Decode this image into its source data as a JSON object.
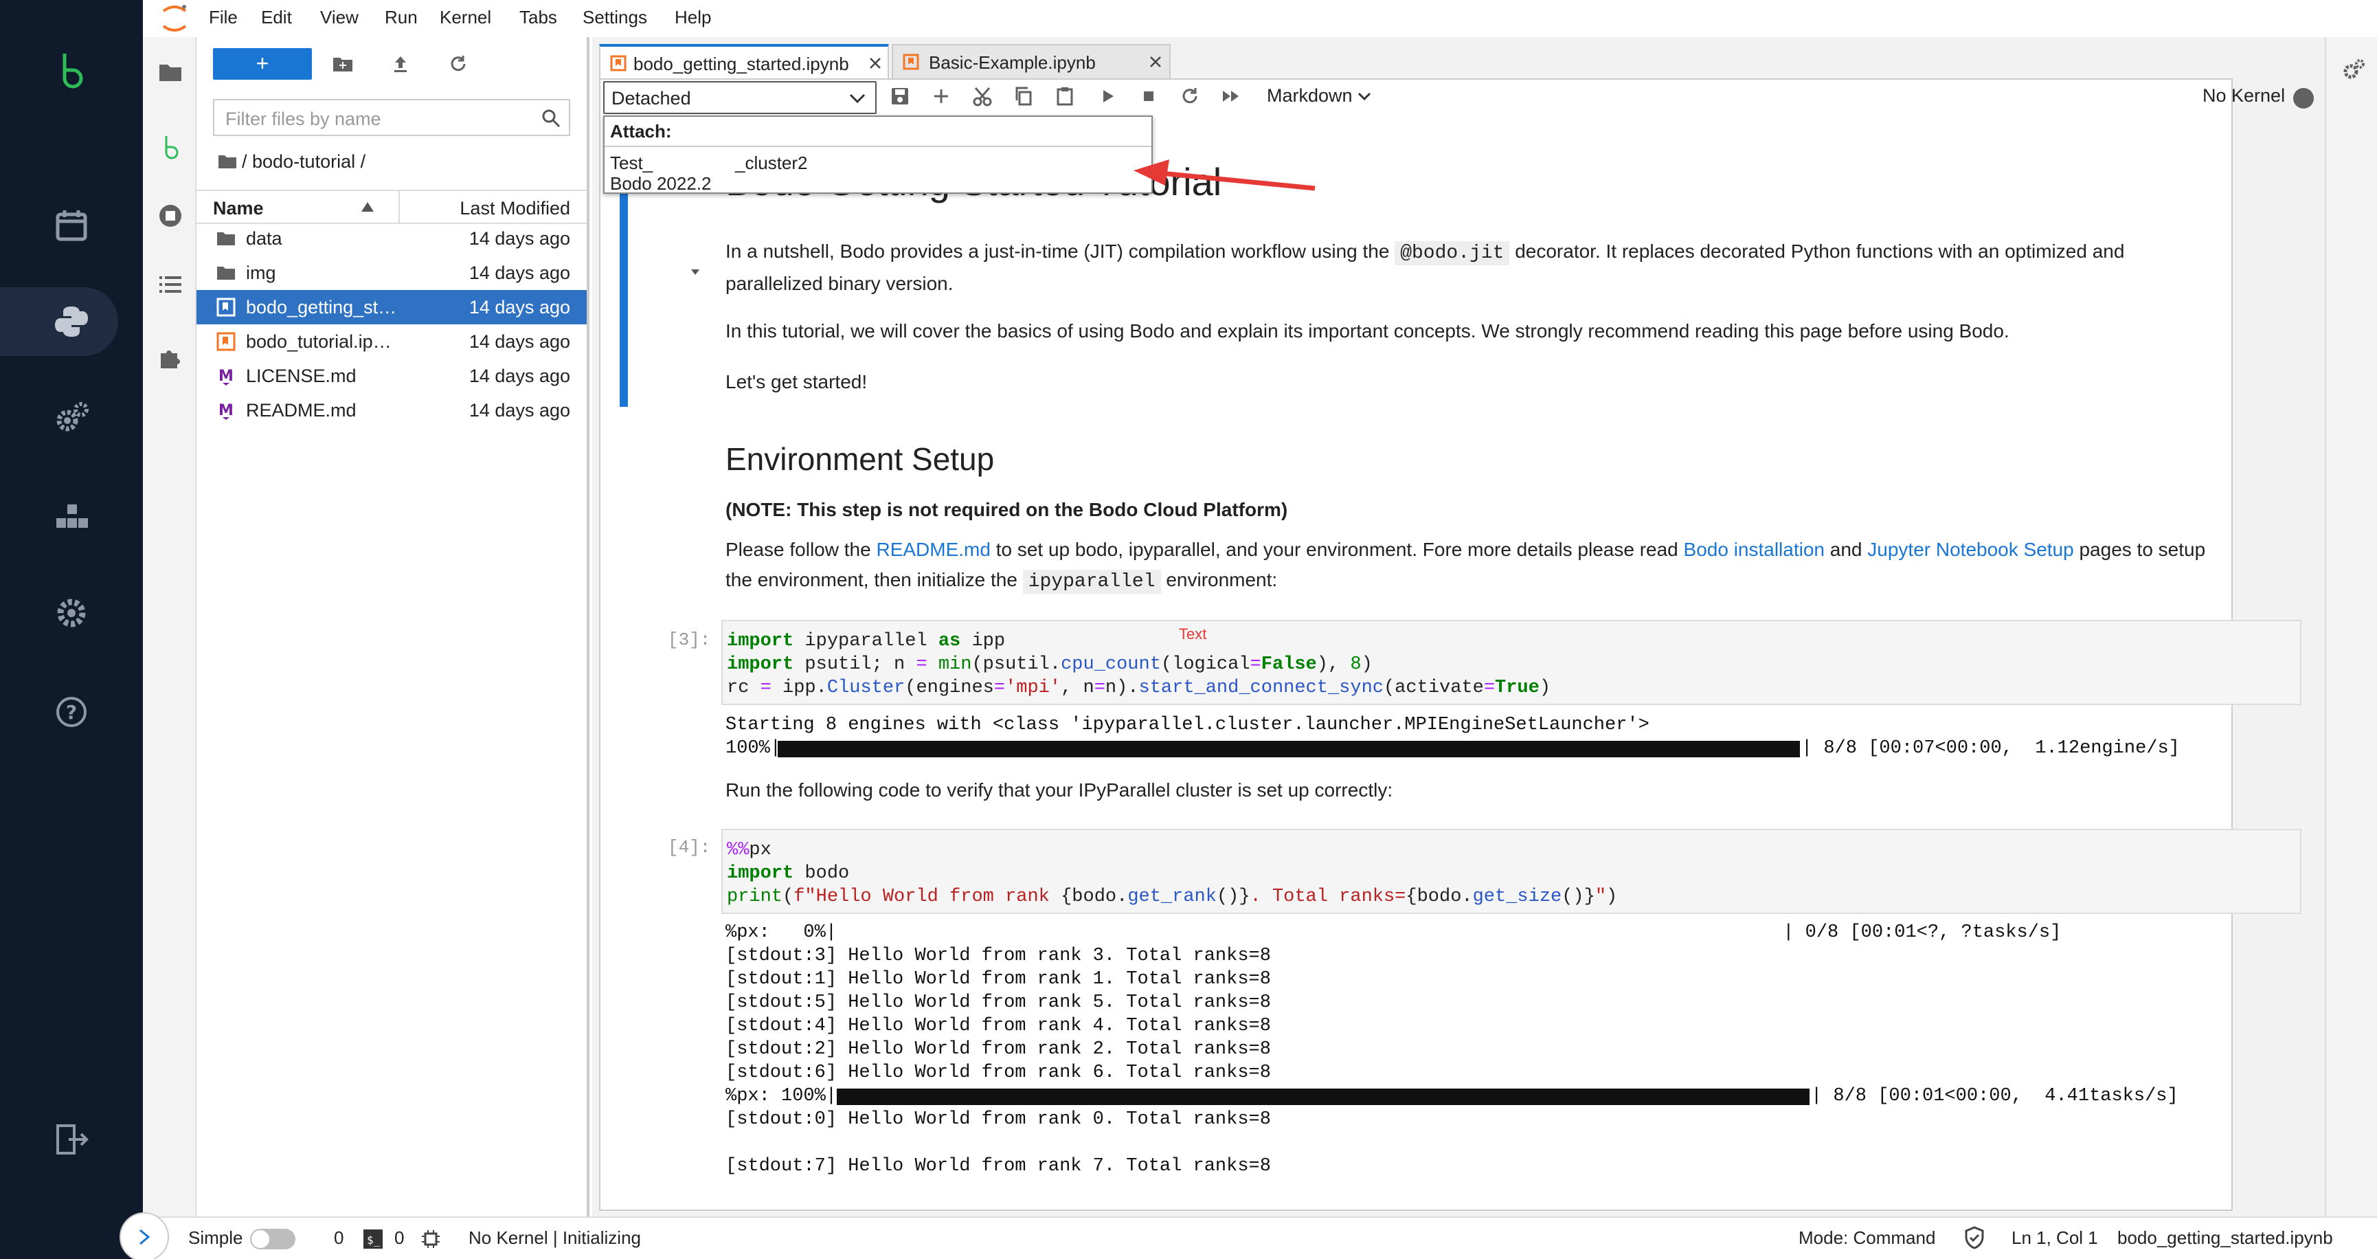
{
  "rail": {
    "icons": [
      "bodo-logo-icon",
      "calendar-icon",
      "python-icon",
      "gears-icon",
      "blocks-icon",
      "gear-icon",
      "help-icon",
      "logout-icon"
    ]
  },
  "menu": [
    "File",
    "Edit",
    "View",
    "Run",
    "Kernel",
    "Tabs",
    "Settings",
    "Help"
  ],
  "filebrowser": {
    "new_label": "+",
    "filter_placeholder": "Filter files by name",
    "breadcrumb": "/ bodo-tutorial /",
    "col_name": "Name",
    "col_modified": "Last Modified",
    "rows": [
      {
        "name": "data",
        "modified": "14 days ago",
        "icon": "folder-icon"
      },
      {
        "name": "img",
        "modified": "14 days ago",
        "icon": "folder-icon"
      },
      {
        "name": "bodo_getting_st…",
        "modified": "14 days ago",
        "icon": "notebook-icon"
      },
      {
        "name": "bodo_tutorial.ip…",
        "modified": "14 days ago",
        "icon": "notebook-icon"
      },
      {
        "name": "LICENSE.md",
        "modified": "14 days ago",
        "icon": "markdown-icon"
      },
      {
        "name": "README.md",
        "modified": "14 days ago",
        "icon": "markdown-icon"
      }
    ]
  },
  "tabs": [
    {
      "label": "bodo_getting_started.ipynb"
    },
    {
      "label": "Basic-Example.ipynb"
    }
  ],
  "toolbar": {
    "cluster_select": "Detached",
    "cell_type": "Markdown",
    "kernel": "No Kernel"
  },
  "attach": {
    "title": "Attach:",
    "cluster_name_a": "Test_",
    "cluster_name_b": "_cluster2",
    "version": "Bodo 2022.2"
  },
  "notebook": {
    "heading_partial": "Bodo Getting Started Tutorial",
    "p1a": "In a nutshell, Bodo provides a just-in-time (JIT) compilation workflow using the ",
    "p1_code": "@bodo.jit",
    "p1b": " decorator. It replaces decorated Python functions with an optimized and",
    "p1c": "parallelized binary version.",
    "p2": "In this tutorial, we will cover the basics of using Bodo and explain its important concepts. We strongly recommend reading this page before using Bodo.",
    "p3": "Let's get started!",
    "h2": "Environment Setup",
    "note": "(NOTE: This step is not required on the Bodo Cloud Platform)",
    "p4a": "Please follow the ",
    "p4_link1": "README.md",
    "p4b": " to set up bodo, ipyparallel, and your environment. Fore more details please read ",
    "p4_link2": "Bodo installation",
    "p4c": " and ",
    "p4_link3": "Jupyter Notebook Setup",
    "p4d": " pages to setup",
    "p4e": "the environment, then initialize the ",
    "p4_code": "ipyparallel",
    "p4f": " environment:",
    "prompt3": "[3]:",
    "prompt4": "[4]:",
    "text_annotation": "Text",
    "out3_line1": "Starting 8 engines with <class 'ipyparallel.cluster.launcher.MPIEngineSetLauncher'>",
    "out3_line2_a": "100%|",
    "out3_line2_b": "| 8/8 [00:07<00:00,  1.12engine/s]",
    "p5": "Run the following code to verify that your IPyParallel cluster is set up correctly:",
    "out4": [
      "%px:   0%|                                                                                     | 0/8 [00:01<?, ?tasks/s]",
      "[stdout:3] Hello World from rank 3. Total ranks=8",
      "[stdout:1] Hello World from rank 1. Total ranks=8",
      "[stdout:5] Hello World from rank 5. Total ranks=8",
      "[stdout:4] Hello World from rank 4. Total ranks=8",
      "[stdout:2] Hello World from rank 2. Total ranks=8",
      "[stdout:6] Hello World from rank 6. Total ranks=8"
    ],
    "out4_bar_a": "%px: 100%|",
    "out4_bar_b": "| 8/8 [00:01<00:00,  4.41tasks/s]",
    "out4_tail": [
      "[stdout:0] Hello World from rank 0. Total ranks=8",
      "",
      "[stdout:7] Hello World from rank 7. Total ranks=8"
    ]
  },
  "status": {
    "mode_label": "Simple",
    "count1": "0",
    "count2": "0",
    "kernel_status": "No Kernel | Initializing",
    "mode": "Mode: Command",
    "position": "Ln 1, Col 1",
    "file": "bodo_getting_started.ipynb"
  },
  "colors": {
    "rail": "#0f1a2b",
    "accent": "#1976d2",
    "bodo_green": "#2ebd59",
    "arrow": "#e53935"
  }
}
